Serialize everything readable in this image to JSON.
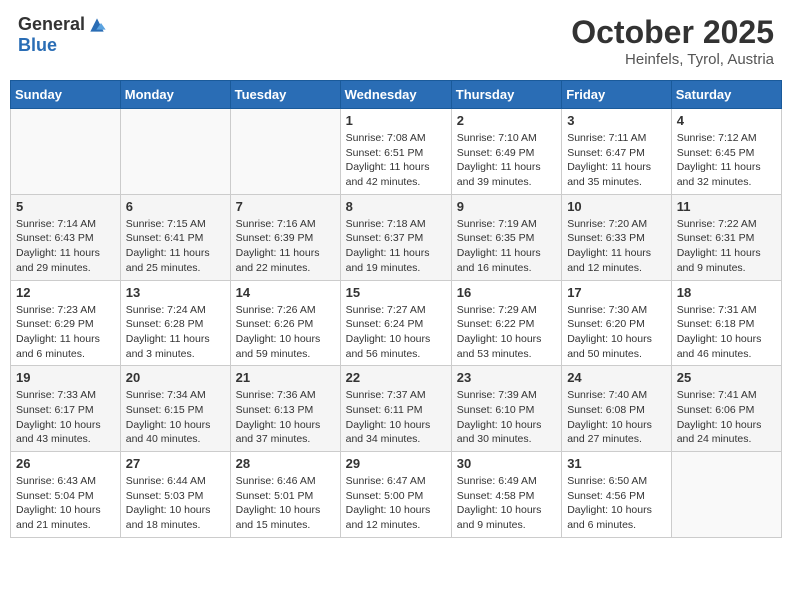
{
  "header": {
    "logo_general": "General",
    "logo_blue": "Blue",
    "month_title": "October 2025",
    "location": "Heinfels, Tyrol, Austria"
  },
  "days_of_week": [
    "Sunday",
    "Monday",
    "Tuesday",
    "Wednesday",
    "Thursday",
    "Friday",
    "Saturday"
  ],
  "weeks": [
    [
      {
        "day": "",
        "info": ""
      },
      {
        "day": "",
        "info": ""
      },
      {
        "day": "",
        "info": ""
      },
      {
        "day": "1",
        "info": "Sunrise: 7:08 AM\nSunset: 6:51 PM\nDaylight: 11 hours and 42 minutes."
      },
      {
        "day": "2",
        "info": "Sunrise: 7:10 AM\nSunset: 6:49 PM\nDaylight: 11 hours and 39 minutes."
      },
      {
        "day": "3",
        "info": "Sunrise: 7:11 AM\nSunset: 6:47 PM\nDaylight: 11 hours and 35 minutes."
      },
      {
        "day": "4",
        "info": "Sunrise: 7:12 AM\nSunset: 6:45 PM\nDaylight: 11 hours and 32 minutes."
      }
    ],
    [
      {
        "day": "5",
        "info": "Sunrise: 7:14 AM\nSunset: 6:43 PM\nDaylight: 11 hours and 29 minutes."
      },
      {
        "day": "6",
        "info": "Sunrise: 7:15 AM\nSunset: 6:41 PM\nDaylight: 11 hours and 25 minutes."
      },
      {
        "day": "7",
        "info": "Sunrise: 7:16 AM\nSunset: 6:39 PM\nDaylight: 11 hours and 22 minutes."
      },
      {
        "day": "8",
        "info": "Sunrise: 7:18 AM\nSunset: 6:37 PM\nDaylight: 11 hours and 19 minutes."
      },
      {
        "day": "9",
        "info": "Sunrise: 7:19 AM\nSunset: 6:35 PM\nDaylight: 11 hours and 16 minutes."
      },
      {
        "day": "10",
        "info": "Sunrise: 7:20 AM\nSunset: 6:33 PM\nDaylight: 11 hours and 12 minutes."
      },
      {
        "day": "11",
        "info": "Sunrise: 7:22 AM\nSunset: 6:31 PM\nDaylight: 11 hours and 9 minutes."
      }
    ],
    [
      {
        "day": "12",
        "info": "Sunrise: 7:23 AM\nSunset: 6:29 PM\nDaylight: 11 hours and 6 minutes."
      },
      {
        "day": "13",
        "info": "Sunrise: 7:24 AM\nSunset: 6:28 PM\nDaylight: 11 hours and 3 minutes."
      },
      {
        "day": "14",
        "info": "Sunrise: 7:26 AM\nSunset: 6:26 PM\nDaylight: 10 hours and 59 minutes."
      },
      {
        "day": "15",
        "info": "Sunrise: 7:27 AM\nSunset: 6:24 PM\nDaylight: 10 hours and 56 minutes."
      },
      {
        "day": "16",
        "info": "Sunrise: 7:29 AM\nSunset: 6:22 PM\nDaylight: 10 hours and 53 minutes."
      },
      {
        "day": "17",
        "info": "Sunrise: 7:30 AM\nSunset: 6:20 PM\nDaylight: 10 hours and 50 minutes."
      },
      {
        "day": "18",
        "info": "Sunrise: 7:31 AM\nSunset: 6:18 PM\nDaylight: 10 hours and 46 minutes."
      }
    ],
    [
      {
        "day": "19",
        "info": "Sunrise: 7:33 AM\nSunset: 6:17 PM\nDaylight: 10 hours and 43 minutes."
      },
      {
        "day": "20",
        "info": "Sunrise: 7:34 AM\nSunset: 6:15 PM\nDaylight: 10 hours and 40 minutes."
      },
      {
        "day": "21",
        "info": "Sunrise: 7:36 AM\nSunset: 6:13 PM\nDaylight: 10 hours and 37 minutes."
      },
      {
        "day": "22",
        "info": "Sunrise: 7:37 AM\nSunset: 6:11 PM\nDaylight: 10 hours and 34 minutes."
      },
      {
        "day": "23",
        "info": "Sunrise: 7:39 AM\nSunset: 6:10 PM\nDaylight: 10 hours and 30 minutes."
      },
      {
        "day": "24",
        "info": "Sunrise: 7:40 AM\nSunset: 6:08 PM\nDaylight: 10 hours and 27 minutes."
      },
      {
        "day": "25",
        "info": "Sunrise: 7:41 AM\nSunset: 6:06 PM\nDaylight: 10 hours and 24 minutes."
      }
    ],
    [
      {
        "day": "26",
        "info": "Sunrise: 6:43 AM\nSunset: 5:04 PM\nDaylight: 10 hours and 21 minutes."
      },
      {
        "day": "27",
        "info": "Sunrise: 6:44 AM\nSunset: 5:03 PM\nDaylight: 10 hours and 18 minutes."
      },
      {
        "day": "28",
        "info": "Sunrise: 6:46 AM\nSunset: 5:01 PM\nDaylight: 10 hours and 15 minutes."
      },
      {
        "day": "29",
        "info": "Sunrise: 6:47 AM\nSunset: 5:00 PM\nDaylight: 10 hours and 12 minutes."
      },
      {
        "day": "30",
        "info": "Sunrise: 6:49 AM\nSunset: 4:58 PM\nDaylight: 10 hours and 9 minutes."
      },
      {
        "day": "31",
        "info": "Sunrise: 6:50 AM\nSunset: 4:56 PM\nDaylight: 10 hours and 6 minutes."
      },
      {
        "day": "",
        "info": ""
      }
    ]
  ]
}
